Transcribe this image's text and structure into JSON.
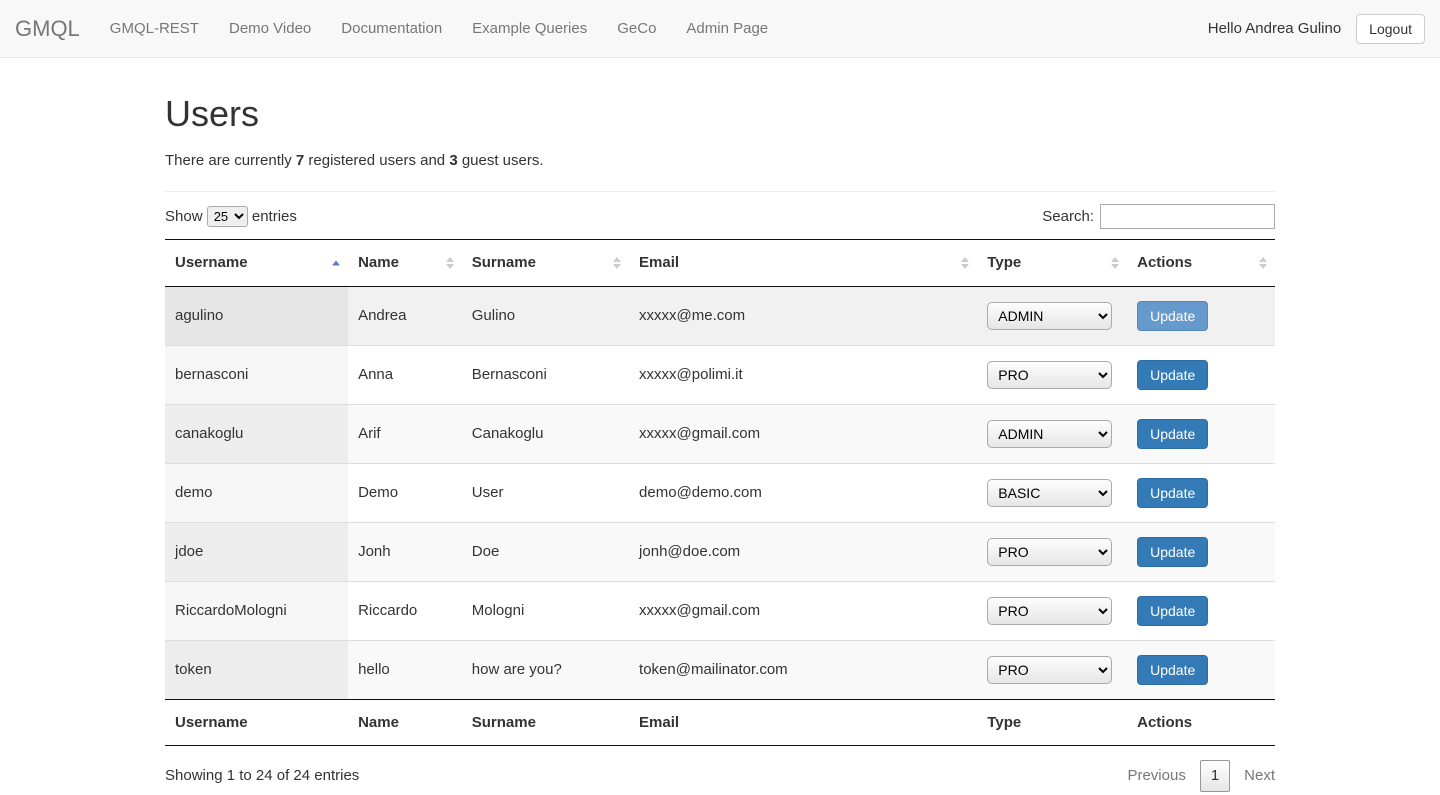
{
  "navbar": {
    "brand": "GMQL",
    "links": [
      "GMQL-REST",
      "Demo Video",
      "Documentation",
      "Example Queries",
      "GeCo",
      "Admin Page"
    ],
    "greeting": "Hello Andrea Gulino",
    "logout": "Logout"
  },
  "page": {
    "title": "Users",
    "subtitle_prefix": "There are currently ",
    "registered_count": "7",
    "subtitle_mid": " registered users and ",
    "guest_count": "3",
    "subtitle_suffix": " guest users."
  },
  "datatable": {
    "length_prefix": "Show ",
    "length_value": "25",
    "length_suffix": " entries",
    "search_label": "Search:",
    "info": "Showing 1 to 24 of 24 entries",
    "prev": "Previous",
    "next": "Next",
    "page": "1"
  },
  "columns": [
    "Username",
    "Name",
    "Surname",
    "Email",
    "Type",
    "Actions"
  ],
  "type_options": [
    "ADMIN",
    "PRO",
    "BASIC"
  ],
  "action_label": "Update",
  "rows": [
    {
      "username": "agulino",
      "name": "Andrea",
      "surname": "Gulino",
      "email": "xxxxx@me.com",
      "type": "ADMIN",
      "highlight": true
    },
    {
      "username": "bernasconi",
      "name": "Anna",
      "surname": "Bernasconi",
      "email": "xxxxx@polimi.it",
      "type": "PRO",
      "highlight": false
    },
    {
      "username": "canakoglu",
      "name": "Arif",
      "surname": "Canakoglu",
      "email": "xxxxx@gmail.com",
      "type": "ADMIN",
      "highlight": false
    },
    {
      "username": "demo",
      "name": "Demo",
      "surname": "User",
      "email": "demo@demo.com",
      "type": "BASIC",
      "highlight": false
    },
    {
      "username": "jdoe",
      "name": "Jonh",
      "surname": "Doe",
      "email": "jonh@doe.com",
      "type": "PRO",
      "highlight": false
    },
    {
      "username": "RiccardoMologni",
      "name": "Riccardo",
      "surname": "Mologni",
      "email": "xxxxx@gmail.com",
      "type": "PRO",
      "highlight": false
    },
    {
      "username": "token",
      "name": "hello",
      "surname": "how are you?",
      "email": "token@mailinator.com",
      "type": "PRO",
      "highlight": false
    }
  ]
}
